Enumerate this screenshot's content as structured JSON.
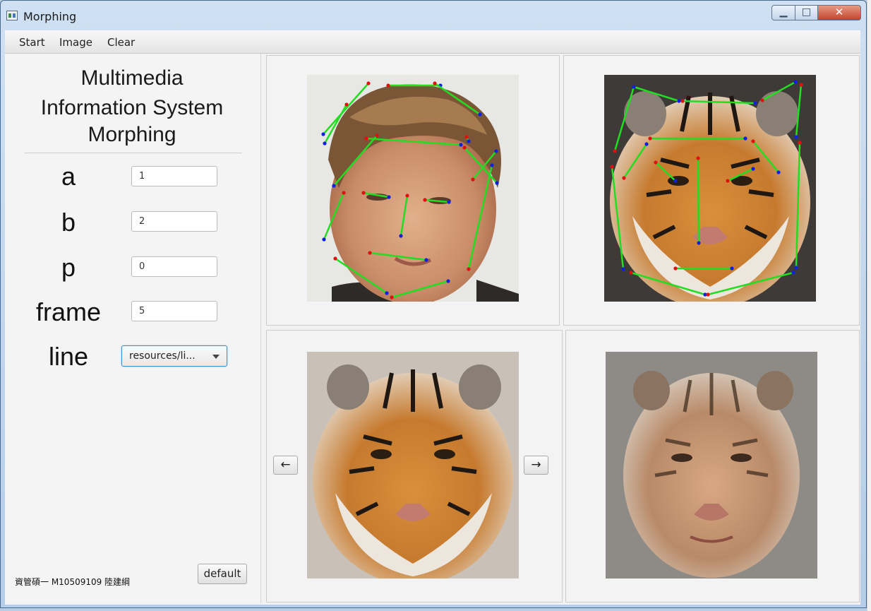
{
  "window": {
    "title": "Morphing"
  },
  "menu": {
    "items": [
      "Start",
      "Image",
      "Clear"
    ]
  },
  "sidebar": {
    "heading": [
      "Multimedia",
      "Information System",
      "Morphing"
    ],
    "params": [
      {
        "label": "a",
        "value": "1"
      },
      {
        "label": "b",
        "value": "2"
      },
      {
        "label": "p",
        "value": "0"
      },
      {
        "label": "frame",
        "value": "5"
      }
    ],
    "line": {
      "label": "line",
      "selected": "resources/li..."
    },
    "footer": "資管碩一 M10509109 陸建綱",
    "default_label": "default"
  },
  "nav": {
    "prev": "←",
    "next": "→"
  },
  "colors": {
    "line_segment": "#22dd22",
    "start_point": "#e01010",
    "end_point": "#1020e0"
  },
  "icons": [
    "app-icon",
    "minimize-icon",
    "maximize-icon",
    "close-icon",
    "left-arrow-icon",
    "right-arrow-icon",
    "dropdown-arrow-icon"
  ]
}
